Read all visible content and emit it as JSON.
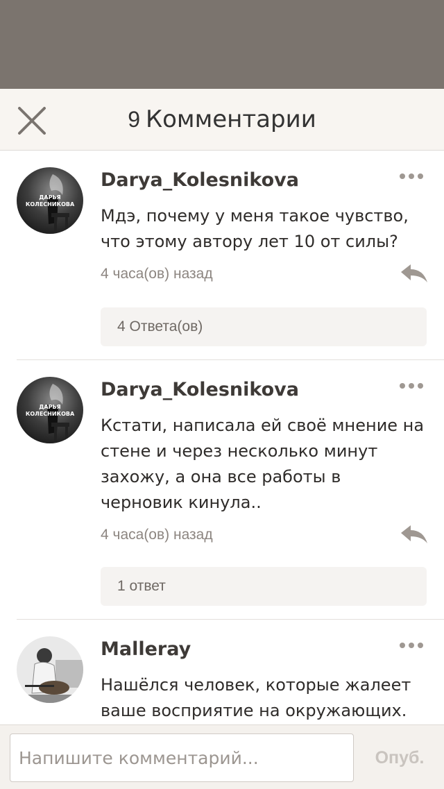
{
  "header": {
    "count": "9",
    "title": "Комментарии",
    "close_icon": "close-icon"
  },
  "comments": [
    {
      "author": "Darya_Kolesnikova",
      "avatar_text": "Дарья Колесникова",
      "text": "Мдэ, почему у меня такое чувство, что этому автору лет 10 от силы?",
      "time": "4 часа(ов) назад",
      "replies": "4 Ответа(ов)"
    },
    {
      "author": "Darya_Kolesnikova",
      "avatar_text": "Дарья Колесникова",
      "text": "Кстати, написала ей своё мнение на стене и через несколько минут захожу, а она все работы в черновик кинула..",
      "time": "4 часа(ов) назад",
      "replies": "1 ответ"
    },
    {
      "author": "Malleray",
      "text": "Нашёлся человек, которые жалеет ваше восприятие на окружающих."
    }
  ],
  "footer": {
    "placeholder": "Напишите комментарий...",
    "publish_label": "Опуб."
  },
  "colors": {
    "overlay": "#7b746e",
    "header_bg": "#f8f5f1",
    "icon_gray": "#9f9892",
    "reply_bg": "#f5f3f1",
    "publish_disabled": "#c9c4bf"
  }
}
